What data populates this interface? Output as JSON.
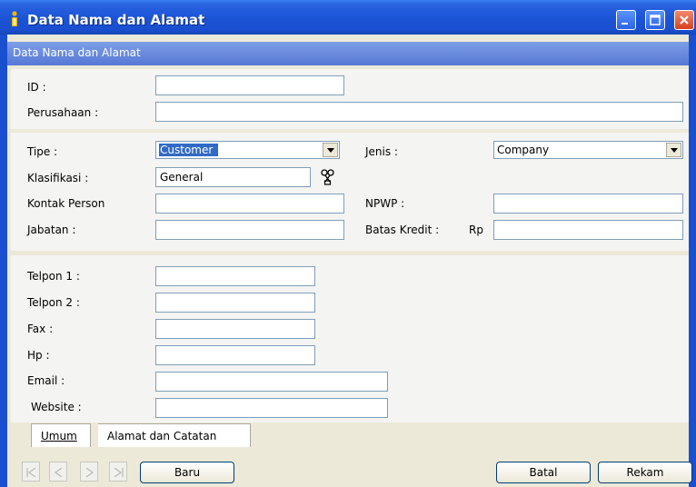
{
  "window": {
    "title": "Data Nama dan Alamat"
  },
  "header": {
    "title": "Data Nama dan Alamat"
  },
  "section1": {
    "id_label": "ID :",
    "id_value": "",
    "perusahaan_label": "Perusahaan :",
    "perusahaan_value": ""
  },
  "section2": {
    "tipe_label": "Tipe :",
    "tipe_value": "Customer",
    "jenis_label": "Jenis :",
    "jenis_value": "Company",
    "klasifikasi_label": "Klasifikasi :",
    "klasifikasi_value": "General",
    "kontak_label": "Kontak Person",
    "kontak_value": "",
    "npwp_label": "NPWP :",
    "npwp_value": "",
    "jabatan_label": "Jabatan :",
    "jabatan_value": "",
    "batas_label": "Batas Kredit :",
    "batas_currency": "Rp",
    "batas_value": ""
  },
  "section3": {
    "telpon1_label": "Telpon 1 :",
    "telpon2_label": "Telpon 2 :",
    "fax_label": "Fax :",
    "hp_label": "Hp :",
    "email_label": "Email :",
    "website_label": "Website :"
  },
  "tabs": {
    "umum": "Umum",
    "alamat": "Alamat dan Catatan"
  },
  "buttons": {
    "baru": "Baru",
    "batal": "Batal",
    "rekam": "Rekam"
  },
  "icons": {
    "app": "info-icon",
    "lookup": "scissors-lookup-icon",
    "nav_first": "first-record-icon",
    "nav_prev": "prev-record-icon",
    "nav_next": "next-record-icon",
    "nav_last": "last-record-icon"
  },
  "colors": {
    "titlebar": "#1c54d6",
    "header_band": "#6a8be0",
    "selection": "#316ac5",
    "close_button": "#d8401f"
  }
}
